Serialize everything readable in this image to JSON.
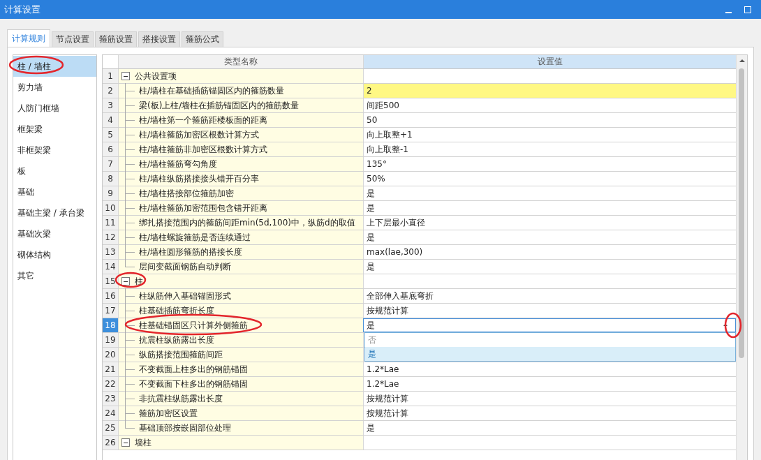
{
  "window": {
    "title": "计算设置"
  },
  "tabs": [
    {
      "label": "计算规则",
      "selected": true
    },
    {
      "label": "节点设置",
      "selected": false
    },
    {
      "label": "箍筋设置",
      "selected": false
    },
    {
      "label": "搭接设置",
      "selected": false
    },
    {
      "label": "箍筋公式",
      "selected": false
    }
  ],
  "sidebar": {
    "items": [
      {
        "label": "柱 / 墙柱",
        "selected": true
      },
      {
        "label": "剪力墙",
        "selected": false
      },
      {
        "label": "人防门框墙",
        "selected": false
      },
      {
        "label": "框架梁",
        "selected": false
      },
      {
        "label": "非框架梁",
        "selected": false
      },
      {
        "label": "板",
        "selected": false
      },
      {
        "label": "基础",
        "selected": false
      },
      {
        "label": "基础主梁 / 承台梁",
        "selected": false
      },
      {
        "label": "基础次梁",
        "selected": false
      },
      {
        "label": "砌体结构",
        "selected": false
      },
      {
        "label": "其它",
        "selected": false
      }
    ]
  },
  "table": {
    "columns": [
      {
        "label": "类型名称",
        "selected": false
      },
      {
        "label": "设置值",
        "selected": true
      }
    ],
    "rows": [
      {
        "kind": "group",
        "number": "1",
        "name": "公共设置项",
        "expanded": true,
        "children": [
          {
            "kind": "setting",
            "number": "2",
            "name": "柱/墙柱在基础插筋锚固区内的箍筋数量",
            "value": "2",
            "highlighted": true,
            "selected": false
          },
          {
            "kind": "setting",
            "number": "3",
            "name": "梁(板)上柱/墙柱在插筋锚固区内的箍筋数量",
            "value": "间距500",
            "highlighted": false,
            "selected": false
          },
          {
            "kind": "setting",
            "number": "4",
            "name": "柱/墙柱第一个箍筋距楼板面的距离",
            "value": "50",
            "highlighted": false,
            "selected": false
          },
          {
            "kind": "setting",
            "number": "5",
            "name": "柱/墙柱箍筋加密区根数计算方式",
            "value": "向上取整+1",
            "highlighted": false,
            "selected": false
          },
          {
            "kind": "setting",
            "number": "6",
            "name": "柱/墙柱箍筋非加密区根数计算方式",
            "value": "向上取整-1",
            "highlighted": false,
            "selected": false
          },
          {
            "kind": "setting",
            "number": "7",
            "name": "柱/墙柱箍筋弯勾角度",
            "value": "135°",
            "highlighted": false,
            "selected": false
          },
          {
            "kind": "setting",
            "number": "8",
            "name": "柱/墙柱纵筋搭接接头错开百分率",
            "value": "50%",
            "highlighted": false,
            "selected": false
          },
          {
            "kind": "setting",
            "number": "9",
            "name": "柱/墙柱搭接部位箍筋加密",
            "value": "是",
            "highlighted": false,
            "selected": false
          },
          {
            "kind": "setting",
            "number": "10",
            "name": "柱/墙柱箍筋加密范围包含错开距离",
            "value": "是",
            "highlighted": false,
            "selected": false
          },
          {
            "kind": "setting",
            "number": "11",
            "name": "绑扎搭接范围内的箍筋间距min(5d,100)中，纵筋d的取值",
            "value": "上下层最小直径",
            "highlighted": false,
            "selected": false
          },
          {
            "kind": "setting",
            "number": "12",
            "name": "柱/墙柱螺旋箍筋是否连续通过",
            "value": "是",
            "highlighted": false,
            "selected": false
          },
          {
            "kind": "setting",
            "number": "13",
            "name": "柱/墙柱圆形箍筋的搭接长度",
            "value": "max(lae,300)",
            "highlighted": false,
            "selected": false
          },
          {
            "kind": "setting",
            "number": "14",
            "name": "层间变截面钢筋自动判断",
            "value": "是",
            "highlighted": false,
            "selected": false
          }
        ]
      },
      {
        "kind": "group",
        "number": "15",
        "name": "柱",
        "expanded": true,
        "children": [
          {
            "kind": "setting",
            "number": "16",
            "name": "柱纵筋伸入基础锚固形式",
            "value": "全部伸入基底弯折",
            "highlighted": false,
            "selected": false
          },
          {
            "kind": "setting",
            "number": "17",
            "name": "柱基础插筋弯折长度",
            "value": "按规范计算",
            "highlighted": false,
            "selected": false
          },
          {
            "kind": "setting",
            "number": "18",
            "name": "柱基础锚固区只计算外侧箍筋",
            "value": "是",
            "highlighted": false,
            "selected": true,
            "dropdown": {
              "options": [
                {
                  "label": "否",
                  "selected": false
                },
                {
                  "label": "是",
                  "selected": true
                }
              ]
            }
          },
          {
            "kind": "setting",
            "number": "19",
            "name": "抗震柱纵筋露出长度",
            "highlighted": false,
            "selected": false
          },
          {
            "kind": "setting",
            "number": "20",
            "name": "纵筋搭接范围箍筋间距",
            "highlighted": false,
            "selected": false
          },
          {
            "kind": "setting",
            "number": "21",
            "name": "不变截面上柱多出的钢筋锚固",
            "value": "1.2*Lae",
            "highlighted": false,
            "selected": false
          },
          {
            "kind": "setting",
            "number": "22",
            "name": "不变截面下柱多出的钢筋锚固",
            "value": "1.2*Lae",
            "highlighted": false,
            "selected": false
          },
          {
            "kind": "setting",
            "number": "23",
            "name": "非抗震柱纵筋露出长度",
            "value": "按规范计算",
            "highlighted": false,
            "selected": false
          },
          {
            "kind": "setting",
            "number": "24",
            "name": "箍筋加密区设置",
            "value": "按规范计算",
            "highlighted": false,
            "selected": false
          },
          {
            "kind": "setting",
            "number": "25",
            "name": "基础顶部按嵌固部位处理",
            "value": "是",
            "highlighted": false,
            "selected": false
          }
        ]
      },
      {
        "kind": "group",
        "number": "26",
        "name": "墙柱",
        "expanded": true
      }
    ]
  }
}
